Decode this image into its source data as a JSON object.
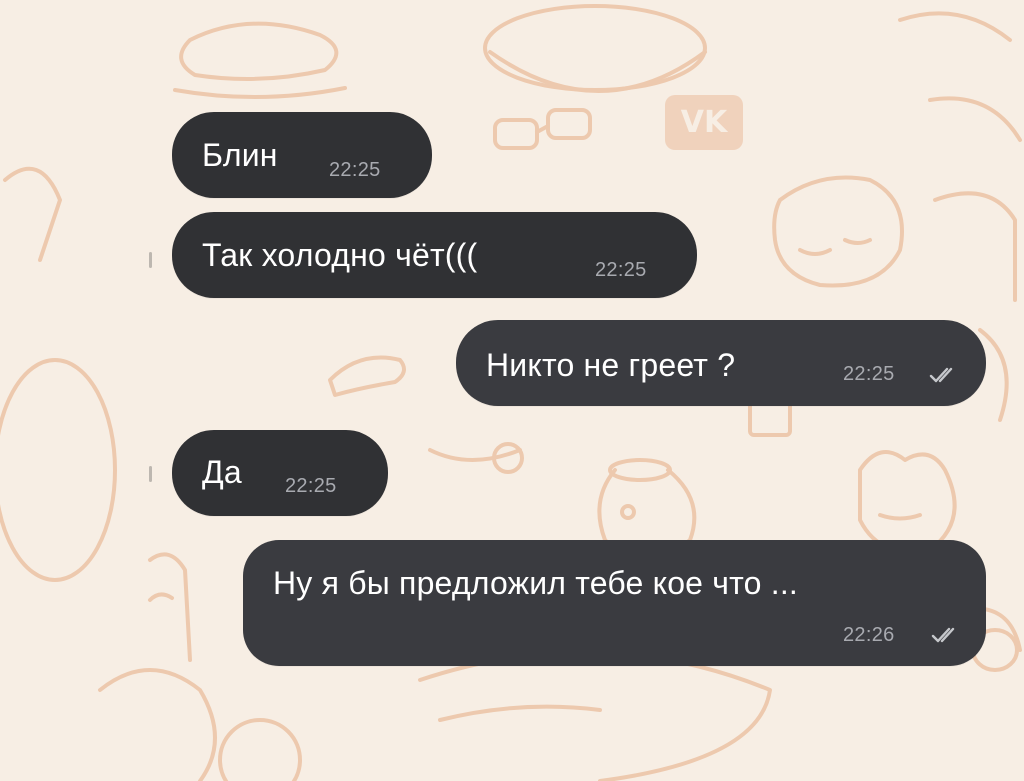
{
  "chat": {
    "background_color": "#f7eee4",
    "bubble_color": "#333437",
    "time_color": "#a8aab0",
    "messages": [
      {
        "direction": "incoming",
        "text": "Блин",
        "time": "22:25"
      },
      {
        "direction": "incoming",
        "text": "Так холодно чёт(((",
        "time": "22:25"
      },
      {
        "direction": "outgoing",
        "text": "Никто не греет ?",
        "time": "22:25",
        "status_icon": "double-check-icon"
      },
      {
        "direction": "incoming",
        "text": "Да",
        "time": "22:25"
      },
      {
        "direction": "outgoing",
        "text": "Ну я бы предложил тебе кое что ...",
        "time": "22:26",
        "status_icon": "double-check-icon"
      }
    ]
  }
}
